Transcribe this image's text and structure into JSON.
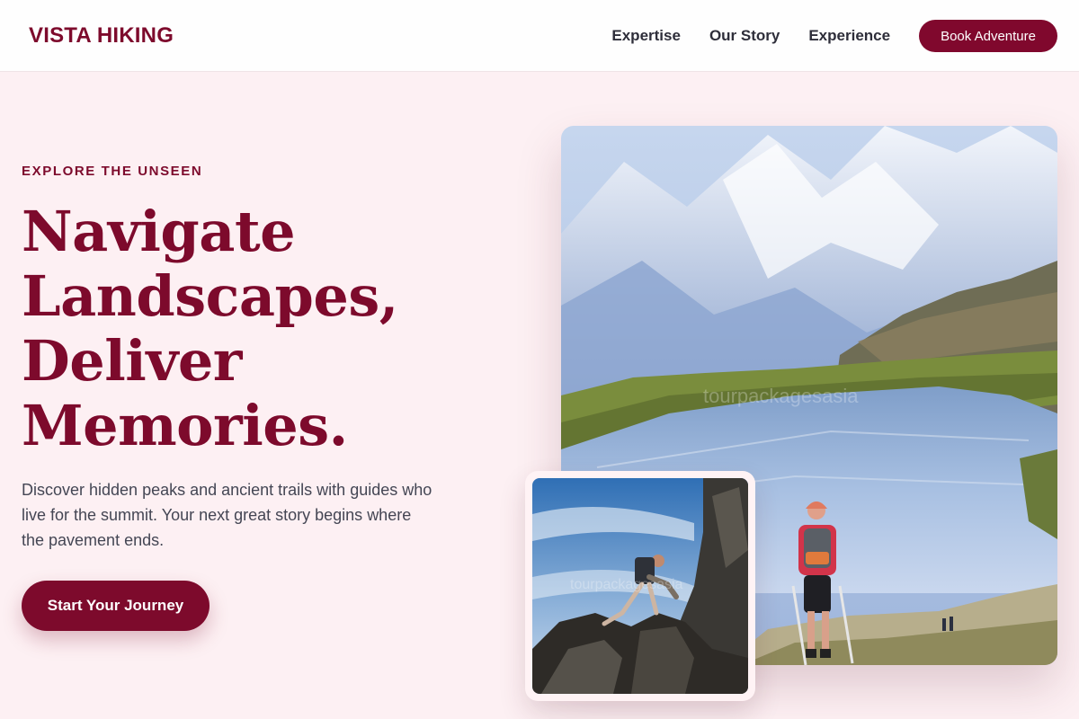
{
  "header": {
    "logo": "VISTA HIKING",
    "nav": [
      "Expertise",
      "Our Story",
      "Experience"
    ],
    "cta_label": "Book Adventure"
  },
  "hero": {
    "eyebrow": "EXPLORE THE UNSEEN",
    "headline_lines": [
      "Navigate",
      "Landscapes,",
      "Deliver",
      "Memories."
    ],
    "subtext": "Discover hidden peaks and ancient trails with guides who live for the summit. Your next great story begins where the pavement ends.",
    "cta_label": "Start Your Journey"
  },
  "images": {
    "main_watermark": "tourpackagesasia",
    "inset_watermark": "tourpackagesasia"
  },
  "colors": {
    "brand": "#7d0a2c",
    "background": "#fdf0f3"
  }
}
